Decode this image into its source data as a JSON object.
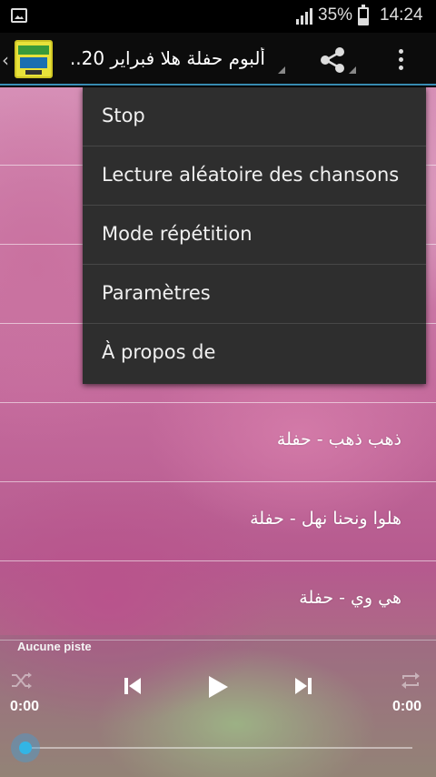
{
  "status_bar": {
    "battery_pct": "35%",
    "time": "14:24",
    "battery_level": 0.35
  },
  "action_bar": {
    "title": "ألبوم حفلة هلا فبراير 20..",
    "icons": [
      "back-arrow-icon",
      "app-logo",
      "share-icon",
      "overflow-menu-icon"
    ]
  },
  "menu": {
    "items": [
      {
        "label": "Stop"
      },
      {
        "label": "Lecture aléatoire des chansons"
      },
      {
        "label": "Mode répétition"
      },
      {
        "label": "Paramètres"
      },
      {
        "label": "À propos de"
      }
    ]
  },
  "songs": [
    {
      "title": ""
    },
    {
      "title": ""
    },
    {
      "title": ""
    },
    {
      "title": ""
    },
    {
      "title": "ذهب ذهب - حفلة"
    },
    {
      "title": "هلوا ونحنا نهل - حفلة"
    },
    {
      "title": "هي وي - حفلة"
    }
  ],
  "player": {
    "status": "Aucune piste",
    "elapsed": "0:00",
    "duration": "0:00",
    "progress": 0,
    "accent_color": "#33b5e5"
  },
  "colors": {
    "action_bar_border": "#3a8fb7",
    "menu_bg": "#2e2e2e"
  }
}
